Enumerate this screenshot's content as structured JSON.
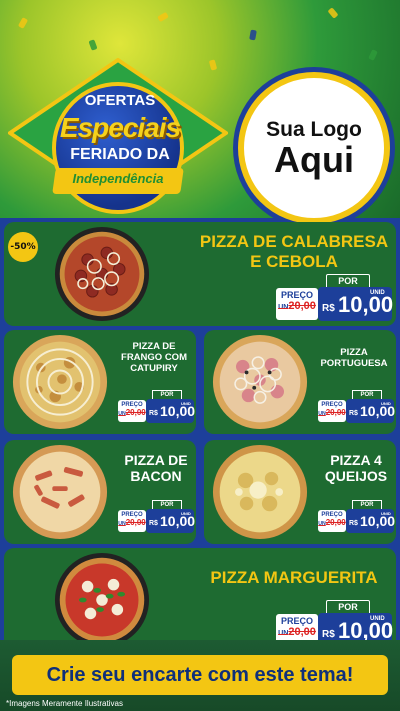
{
  "colors": {
    "blue": "#1d3f9a",
    "green": "#1e6b31",
    "yellow": "#f3c613",
    "red_strike": "#d22222"
  },
  "badge": {
    "line1": "OFERTAS",
    "line2": "Especiais",
    "line3": "FERIADO DA",
    "line4": "Independência"
  },
  "logo": {
    "line1": "Sua Logo",
    "line2": "Aqui"
  },
  "discount_badge": "-50%",
  "products": [
    {
      "title": "PIZZA DE CALABRESA E CEBOLA",
      "preco_label": "PREÇO",
      "old_price": "20,00",
      "old_unit": "UN",
      "por_label": "POR",
      "currency": "R$",
      "new_price": "10,00",
      "unid": "UNID",
      "icon": "pizza-calabresa-image"
    },
    {
      "title": "PIZZA DE FRANGO COM CATUPIRY",
      "preco_label": "PREÇO",
      "old_price": "20,00",
      "old_unit": "UN",
      "por_label": "POR",
      "currency": "R$",
      "new_price": "10,00",
      "unid": "UNID",
      "icon": "pizza-frango-image"
    },
    {
      "title": "PIZZA PORTUGUESA",
      "preco_label": "PREÇO",
      "old_price": "20,00",
      "old_unit": "UN",
      "por_label": "POR",
      "currency": "R$",
      "new_price": "10,00",
      "unid": "UNID",
      "icon": "pizza-portuguesa-image"
    },
    {
      "title": "PIZZA DE BACON",
      "preco_label": "PREÇO",
      "old_price": "20,00",
      "old_unit": "UN",
      "por_label": "POR",
      "currency": "R$",
      "new_price": "10,00",
      "unid": "UNID",
      "icon": "pizza-bacon-image"
    },
    {
      "title": "PIZZA 4 QUEIJOS",
      "preco_label": "PREÇO",
      "old_price": "20,00",
      "old_unit": "UN",
      "por_label": "POR",
      "currency": "R$",
      "new_price": "10,00",
      "unid": "UNID",
      "icon": "pizza-4-queijos-image"
    },
    {
      "title": "PIZZA MARGUERITA",
      "preco_label": "PREÇO",
      "old_price": "20,00",
      "old_unit": "UN",
      "por_label": "POR",
      "currency": "R$",
      "new_price": "10,00",
      "unid": "UNID",
      "icon": "pizza-marguerita-image"
    }
  ],
  "cta": "Crie seu encarte com este tema!",
  "disclaimer": "*Imagens Meramente Ilustrativas"
}
